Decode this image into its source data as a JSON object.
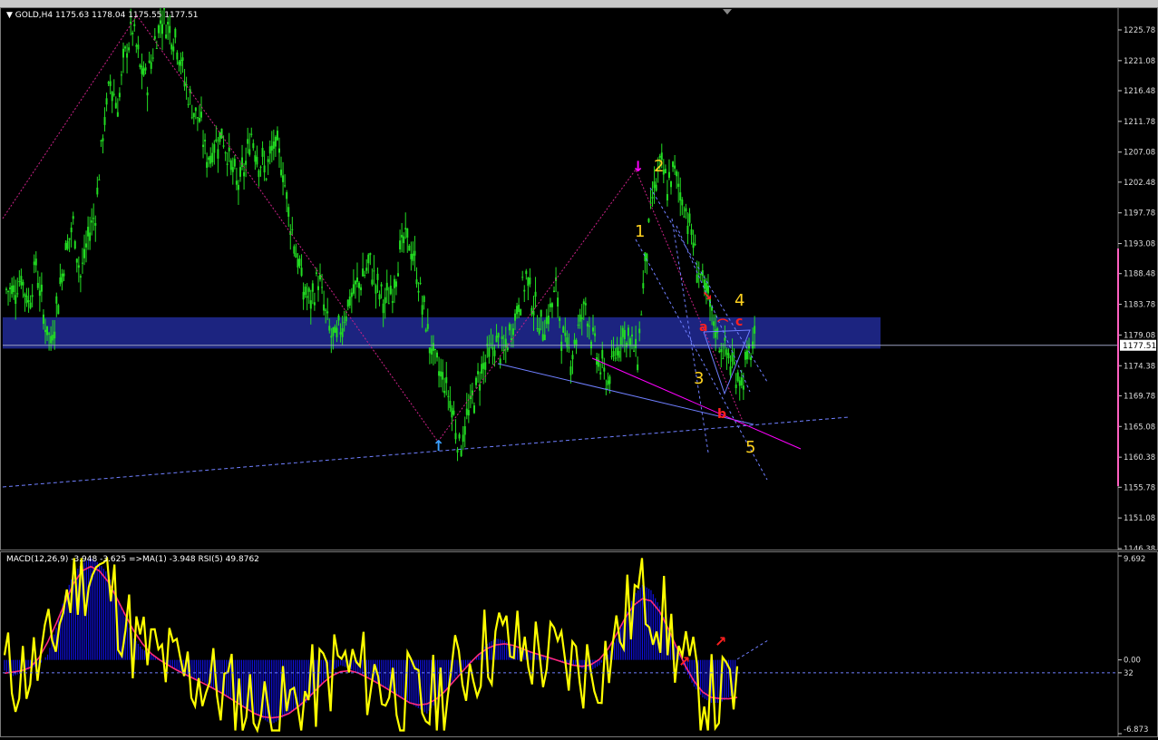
{
  "main_header": {
    "symbol": "GOLD,H4",
    "ohlc": "1175.63 1178.04 1175.55 1177.51"
  },
  "sub_header": {
    "text": "MACD(12,26,9) -3.948 -3.625  =>MA(1) -3.948  RSI(5) 49.8762"
  },
  "current_price_label": "1177.51",
  "colors": {
    "background": "#000000",
    "candle": "#22dd22",
    "zone": "#1c2480",
    "macd_hist": "#1010e0",
    "signal": "#ff2a7a",
    "rsi": "#ffff00",
    "wave_label": "#ffd21f",
    "abc_label": "#ff2020",
    "trend_blue": "#6f7fff",
    "trend_magenta": "#ff00ff",
    "zigzag": "#cc2288"
  },
  "wave_labels": [
    "1",
    "2",
    "3",
    "4",
    "5"
  ],
  "abc_labels": [
    "a",
    "b",
    "c"
  ],
  "chart_data": [
    {
      "type": "candlestick",
      "title": "GOLD,H4",
      "y_ticks": [
        "1225.78",
        "1221.08",
        "1216.48",
        "1211.78",
        "1207.08",
        "1202.48",
        "1197.78",
        "1193.08",
        "1188.48",
        "1183.78",
        "1179.08",
        "1174.38",
        "1169.78",
        "1165.08",
        "1160.38",
        "1155.78",
        "1151.08",
        "1146.38"
      ],
      "ylim": [
        1146.38,
        1228.0
      ],
      "close_path": [
        1186,
        1188,
        1184,
        1190,
        1182,
        1178,
        1185,
        1192,
        1196,
        1188,
        1194,
        1198,
        1210,
        1218,
        1214,
        1222,
        1226,
        1220,
        1218,
        1224,
        1228,
        1226,
        1224,
        1218,
        1214,
        1212,
        1206,
        1208,
        1210,
        1206,
        1202,
        1204,
        1210,
        1206,
        1204,
        1208,
        1206,
        1198,
        1192,
        1186,
        1184,
        1188,
        1182,
        1178,
        1180,
        1184,
        1186,
        1188,
        1190,
        1186,
        1184,
        1186,
        1192,
        1194,
        1190,
        1184,
        1178,
        1174,
        1172,
        1168,
        1162,
        1166,
        1170,
        1174,
        1176,
        1178,
        1176,
        1180,
        1184,
        1188,
        1184,
        1180,
        1182,
        1186,
        1178,
        1176,
        1180,
        1184,
        1178,
        1174,
        1172,
        1176,
        1180,
        1178,
        1176,
        1190,
        1200,
        1205,
        1202,
        1204,
        1200,
        1196,
        1190,
        1186,
        1182,
        1178,
        1176,
        1174,
        1172,
        1176,
        1178
      ],
      "current_price": 1177.51,
      "resistance_zone": [
        1177.0,
        1181.8
      ]
    },
    {
      "type": "line",
      "title": "MACD(12,26,9) -3.948 -3.625  =>MA(1) -3.948  RSI(5) 49.8762",
      "y_ticks": [
        "9.692",
        "0.00",
        "32",
        "-6.873"
      ],
      "ylim": [
        -6.873,
        9.692
      ],
      "macd": [
        -1,
        -1.5,
        -1.2,
        -0.8,
        -0.5,
        0.5,
        3,
        6,
        8,
        9,
        9.5,
        9,
        8,
        6,
        4,
        2,
        1,
        0.5,
        0,
        -0.5,
        -1,
        -1.5,
        -1.8,
        -2,
        -2.5,
        -3,
        -3.5,
        -4,
        -4.5,
        -5,
        -5.5,
        -6,
        -5.5,
        -5,
        -4.5,
        -4,
        -3,
        -2,
        -1,
        -0.5,
        -0.8,
        -1.2,
        -1.5,
        -2,
        -2.5,
        -3,
        -3.5,
        -4,
        -4.5,
        -5,
        -4,
        -3,
        -2,
        -1,
        -0.5,
        0.5,
        1.5,
        2,
        1.8,
        1.2,
        1,
        0.8,
        0.5,
        0.2,
        0,
        -0.2,
        -0.5,
        -0.8,
        -1,
        -0.5,
        0.5,
        2,
        4,
        6,
        7,
        6.5,
        5,
        3,
        1,
        -1,
        -2.5,
        -3.5,
        -4,
        -4,
        -3.5,
        -3
      ]
    }
  ]
}
